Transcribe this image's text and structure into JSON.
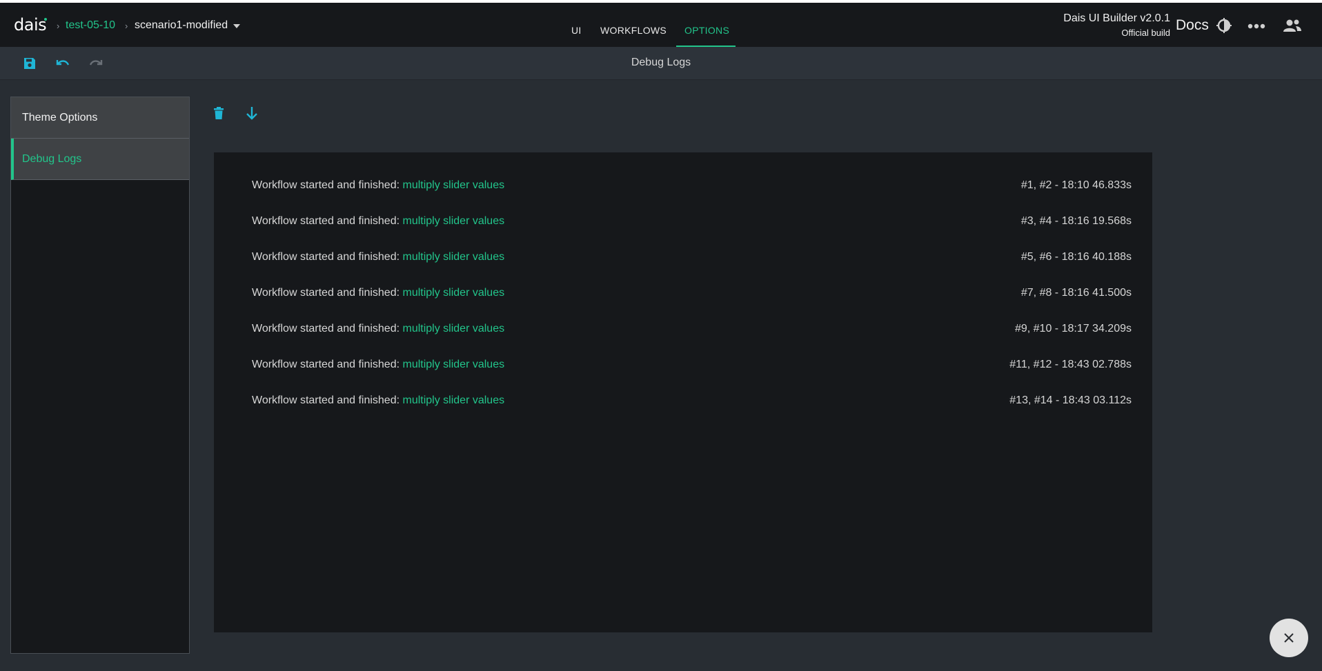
{
  "header": {
    "logo_text": "dais",
    "project": "test-05-10",
    "scenario": "scenario1-modified",
    "separator": "›",
    "tabs": [
      {
        "label": "UI"
      },
      {
        "label": "WORKFLOWS"
      },
      {
        "label": "OPTIONS"
      }
    ],
    "active_tab": "OPTIONS",
    "builder_name": "Dais UI Builder v2.0.1",
    "builder_sub": "Official build",
    "docs_label": "Docs"
  },
  "toolbar": {
    "title": "Debug Logs",
    "icons": [
      "save-icon",
      "undo-icon",
      "redo-icon"
    ]
  },
  "sidebar": {
    "items": [
      {
        "label": "Theme Options"
      },
      {
        "label": "Debug Logs"
      }
    ],
    "active": "Debug Logs"
  },
  "logs": {
    "action_icons": [
      "trash-icon",
      "arrow-down-icon"
    ],
    "entries": [
      {
        "prefix": "Workflow started and finished: ",
        "workflow": "multiply slider values",
        "time": "#1, #2 - 18:10 46.833s"
      },
      {
        "prefix": "Workflow started and finished: ",
        "workflow": "multiply slider values",
        "time": "#3, #4 - 18:16 19.568s"
      },
      {
        "prefix": "Workflow started and finished: ",
        "workflow": "multiply slider values",
        "time": "#5, #6 - 18:16 40.188s"
      },
      {
        "prefix": "Workflow started and finished: ",
        "workflow": "multiply slider values",
        "time": "#7, #8 - 18:16 41.500s"
      },
      {
        "prefix": "Workflow started and finished: ",
        "workflow": "multiply slider values",
        "time": "#9, #10 - 18:17 34.209s"
      },
      {
        "prefix": "Workflow started and finished: ",
        "workflow": "multiply slider values",
        "time": "#11, #12 - 18:43 02.788s"
      },
      {
        "prefix": "Workflow started and finished: ",
        "workflow": "multiply slider values",
        "time": "#13, #14 - 18:43 03.112s"
      }
    ]
  },
  "colors": {
    "accent": "#22c58b",
    "icon_accent": "#1fb6d6",
    "background": "#282d33",
    "panel": "#16181b"
  }
}
